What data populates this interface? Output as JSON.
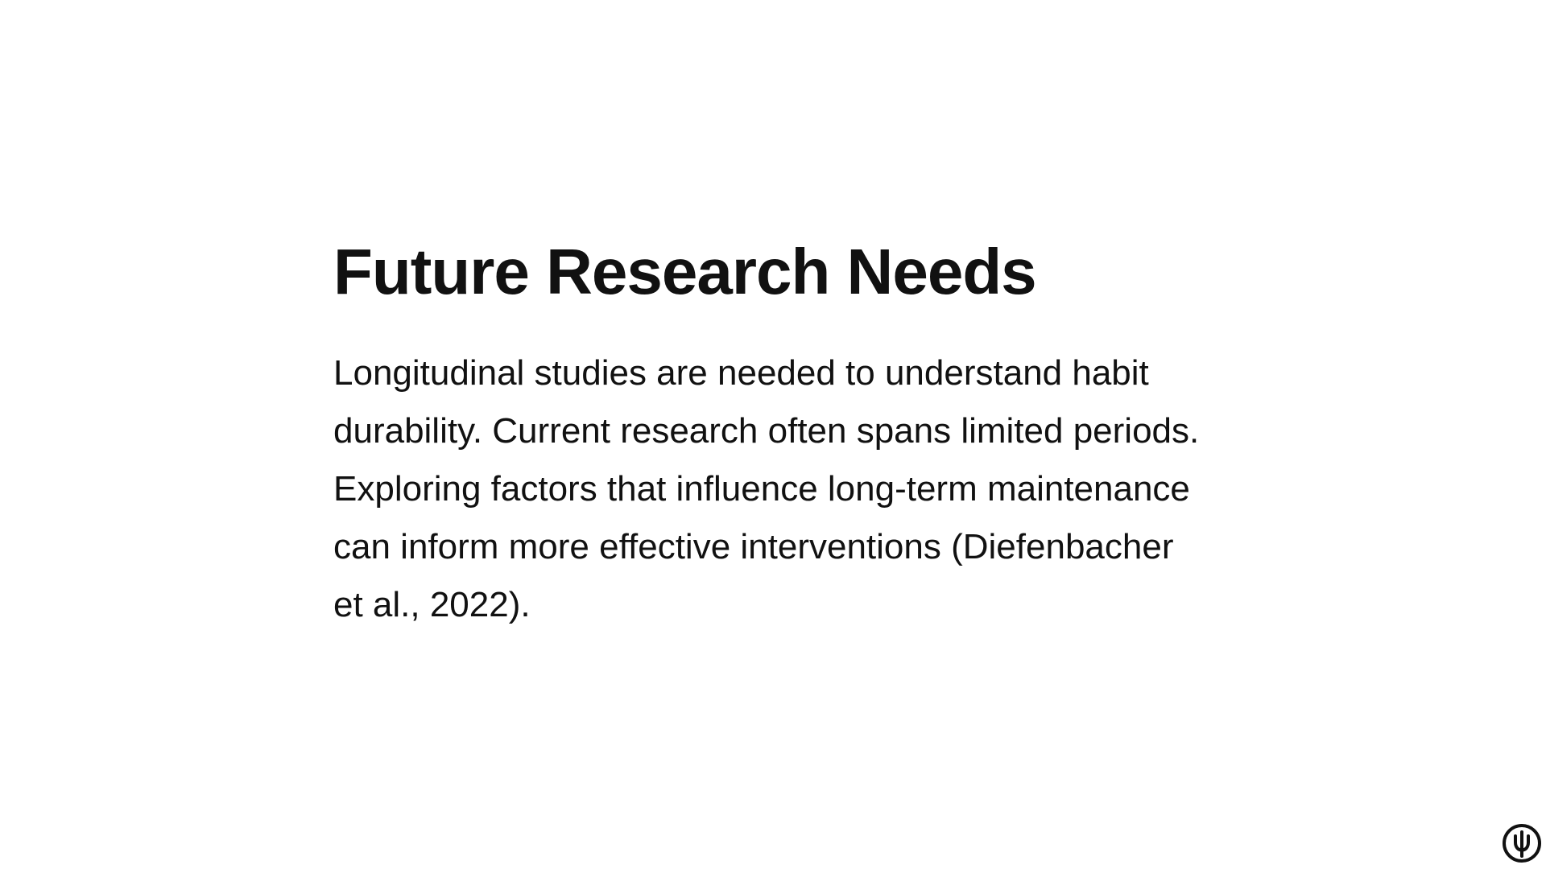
{
  "slide": {
    "title": "Future Research Needs",
    "body": "Longitudinal studies are needed to understand habit durability. Current research often spans limited periods. Exploring factors that influence long-term maintenance can inform more effective interventions (Diefenbacher et al., 2022).",
    "logo_icon": "psi-circle-icon"
  },
  "colors": {
    "background": "#ffffff",
    "text": "#111111"
  }
}
